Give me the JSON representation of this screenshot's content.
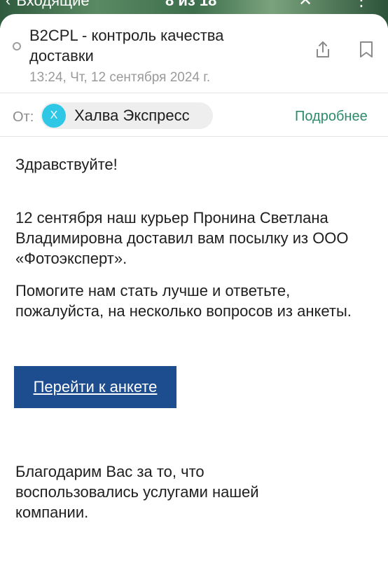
{
  "nav": {
    "back_label": "Входящие",
    "counter": "8 из 18"
  },
  "message": {
    "subject": "B2CPL - контроль качества доставки",
    "datetime": "13:24, Чт, 12 сентября 2024 г.",
    "from_label": "От:",
    "sender_initial": "Х",
    "sender_name": "Халва Экспресс",
    "details_link": "Подробнее"
  },
  "body": {
    "greeting": "Здравствуйте!",
    "paragraph1": "12 сентября наш курьер Пронина Светлана Владимировна доставил вам посылку из ООО «Фотоэксперт».",
    "paragraph2": "Помогите нам стать лучше и ответьте, пожалуйста, на несколько вопросов из анкеты.",
    "cta_label": "Перейти к анкете",
    "closing": "Благодарим Вас за то, что воспользовались услугами нашей компании."
  },
  "colors": {
    "accent_link": "#2e8b6a",
    "cta_background": "#1e4d8f",
    "avatar_background": "#2ec8e6"
  },
  "icons": {
    "share": "share-icon",
    "bookmark": "bookmark-icon",
    "back": "chevron-left-icon",
    "close": "close-icon"
  }
}
